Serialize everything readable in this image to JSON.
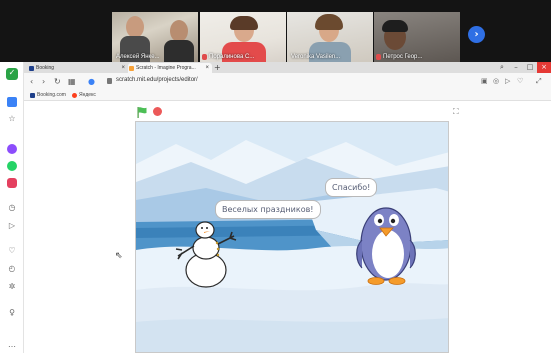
{
  "conference": {
    "participants": [
      {
        "name": "Алексей Янке..."
      },
      {
        "name": "Поралинова С..."
      },
      {
        "name": "Veronika Vasilen..."
      },
      {
        "name": "Петрос Геор..."
      }
    ],
    "next_icon": "chevron-right"
  },
  "browser": {
    "tabs": [
      {
        "title": "Scratch - Imagine Progra...",
        "active": true
      },
      {
        "title": "Booking",
        "active": false
      }
    ],
    "url": "scratch.mit.edu/projects/editor/",
    "bookmarks": [
      {
        "label": "Booking.com"
      },
      {
        "label": "Яндекс"
      }
    ]
  },
  "scratch": {
    "snowman_speech": "Веселых праздников!",
    "penguin_speech": "Спасибо!"
  },
  "colors": {
    "flag_green": "#4cbf56",
    "stop_red": "#ec5959",
    "accent_blue": "#2f6fe4"
  }
}
